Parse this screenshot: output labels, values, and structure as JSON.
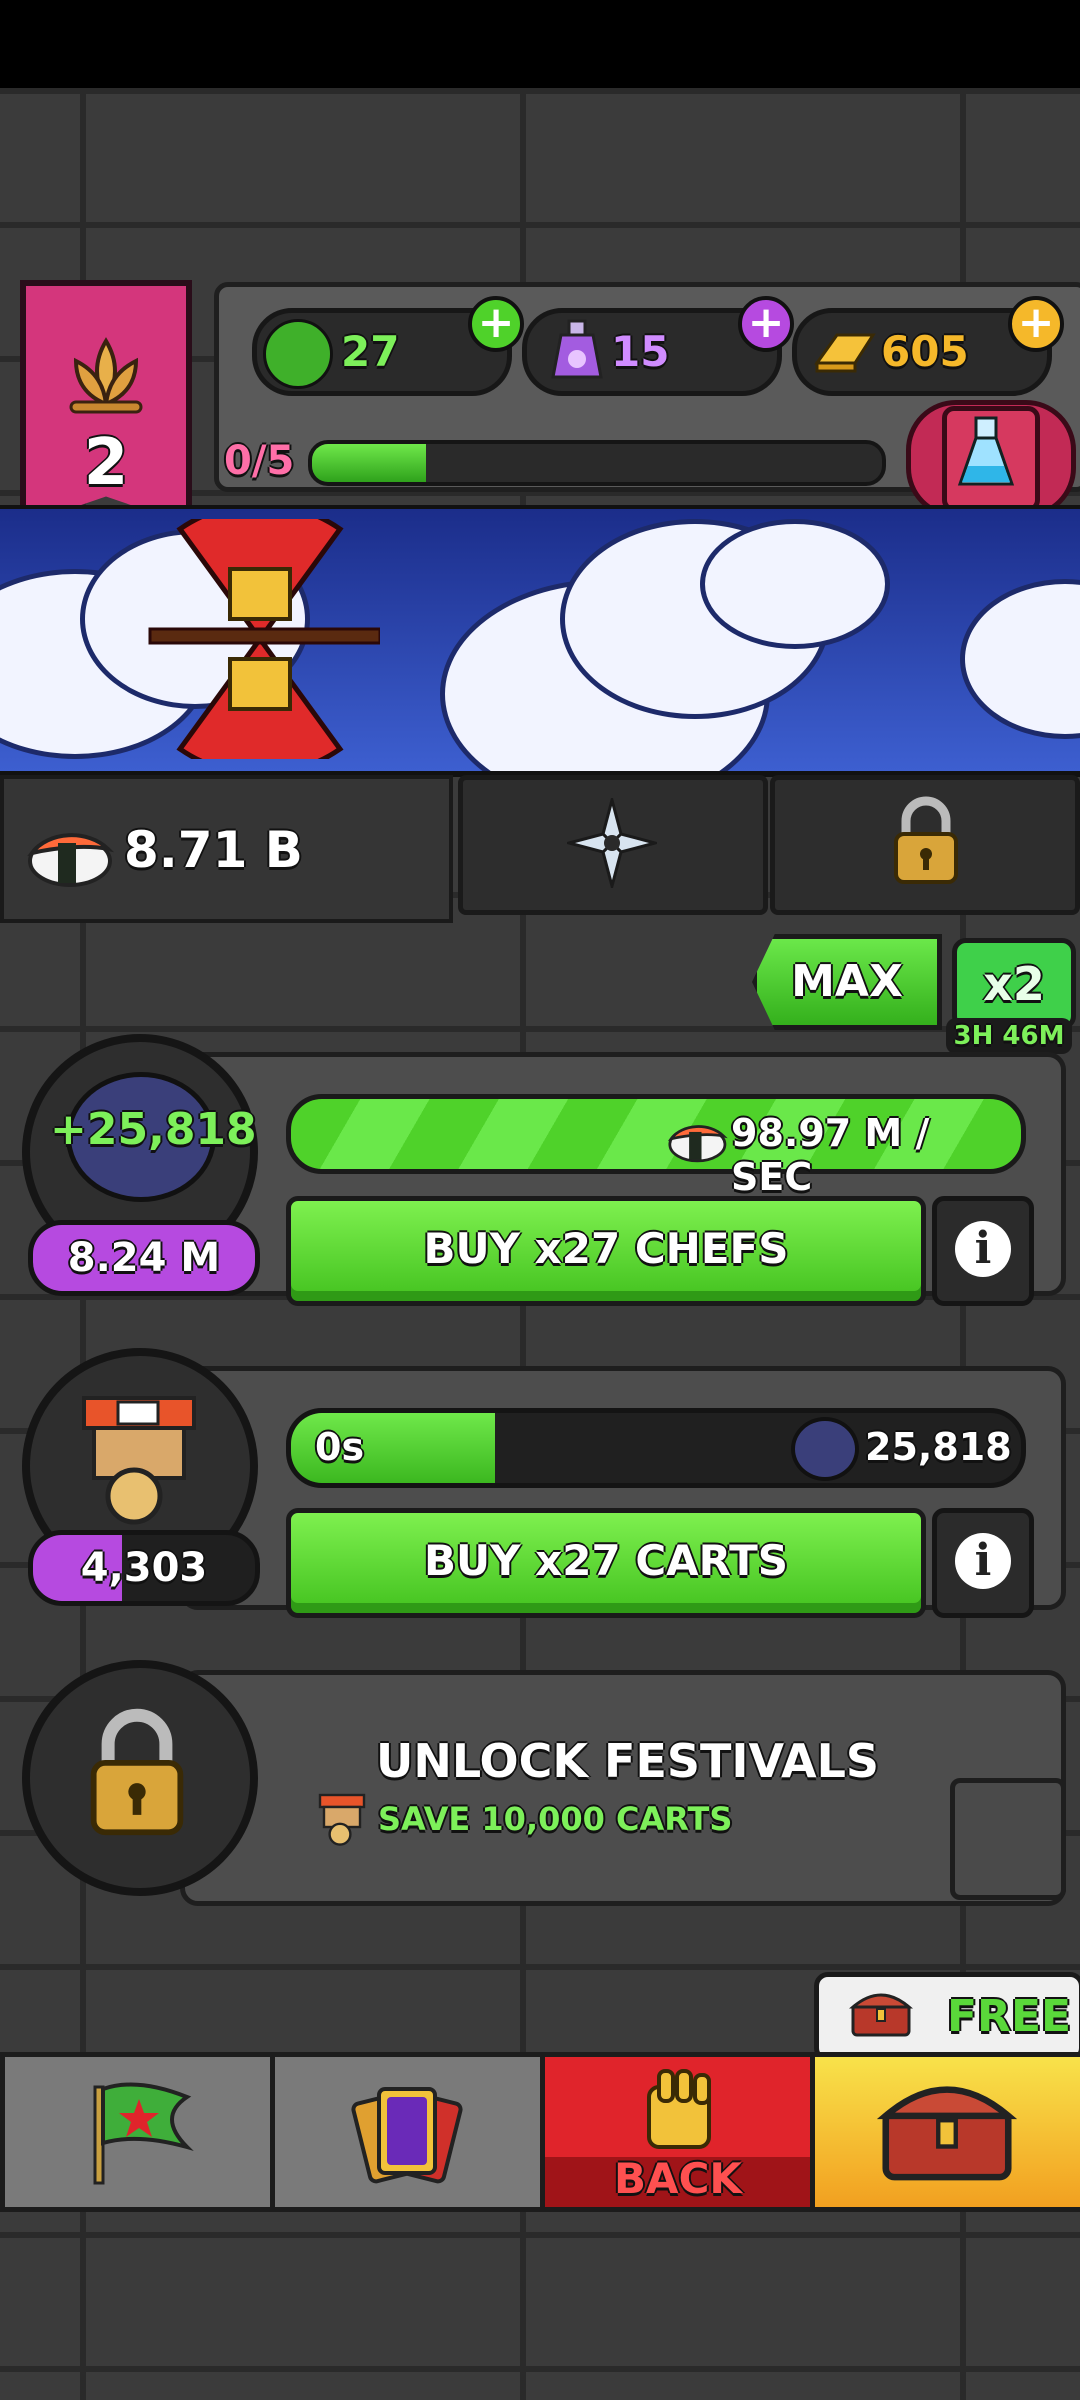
{
  "resources": {
    "gems": {
      "value": "27",
      "icon": "green-mask-icon"
    },
    "potions": {
      "value": "15",
      "icon": "purple-potion-icon"
    },
    "gold": {
      "value": "605",
      "icon": "gold-bar-icon"
    }
  },
  "level": {
    "number": "2",
    "progress_text": "0/5",
    "progress_fraction": 0.2
  },
  "currency": {
    "sushi_total": "8.71 B"
  },
  "boost": {
    "max_label": "MAX",
    "multiplier": "x2",
    "timer": "3H 46M"
  },
  "chefs": {
    "gain": "+25,818",
    "owned": "8.24 M",
    "rate": "98.97 M / SEC",
    "buy_label": "BUY x27 CHEFS"
  },
  "carts": {
    "timer": "0s",
    "timer_fraction": 0.28,
    "cost": "25,818",
    "owned": "4,303",
    "owned_fraction": 0.4,
    "buy_label": "BUY x27 CARTS"
  },
  "festivals": {
    "title": "UNLOCK FESTIVALS",
    "requirement": "SAVE 10,000 CARTS"
  },
  "nav": {
    "back_label": "BACK",
    "free_label": "FREE"
  },
  "colors": {
    "accent_green": "#4fd22a",
    "banner_pink": "#d4367c",
    "gold": "#f5b82a",
    "purple": "#b64ae0",
    "back_red": "#e0242b"
  }
}
